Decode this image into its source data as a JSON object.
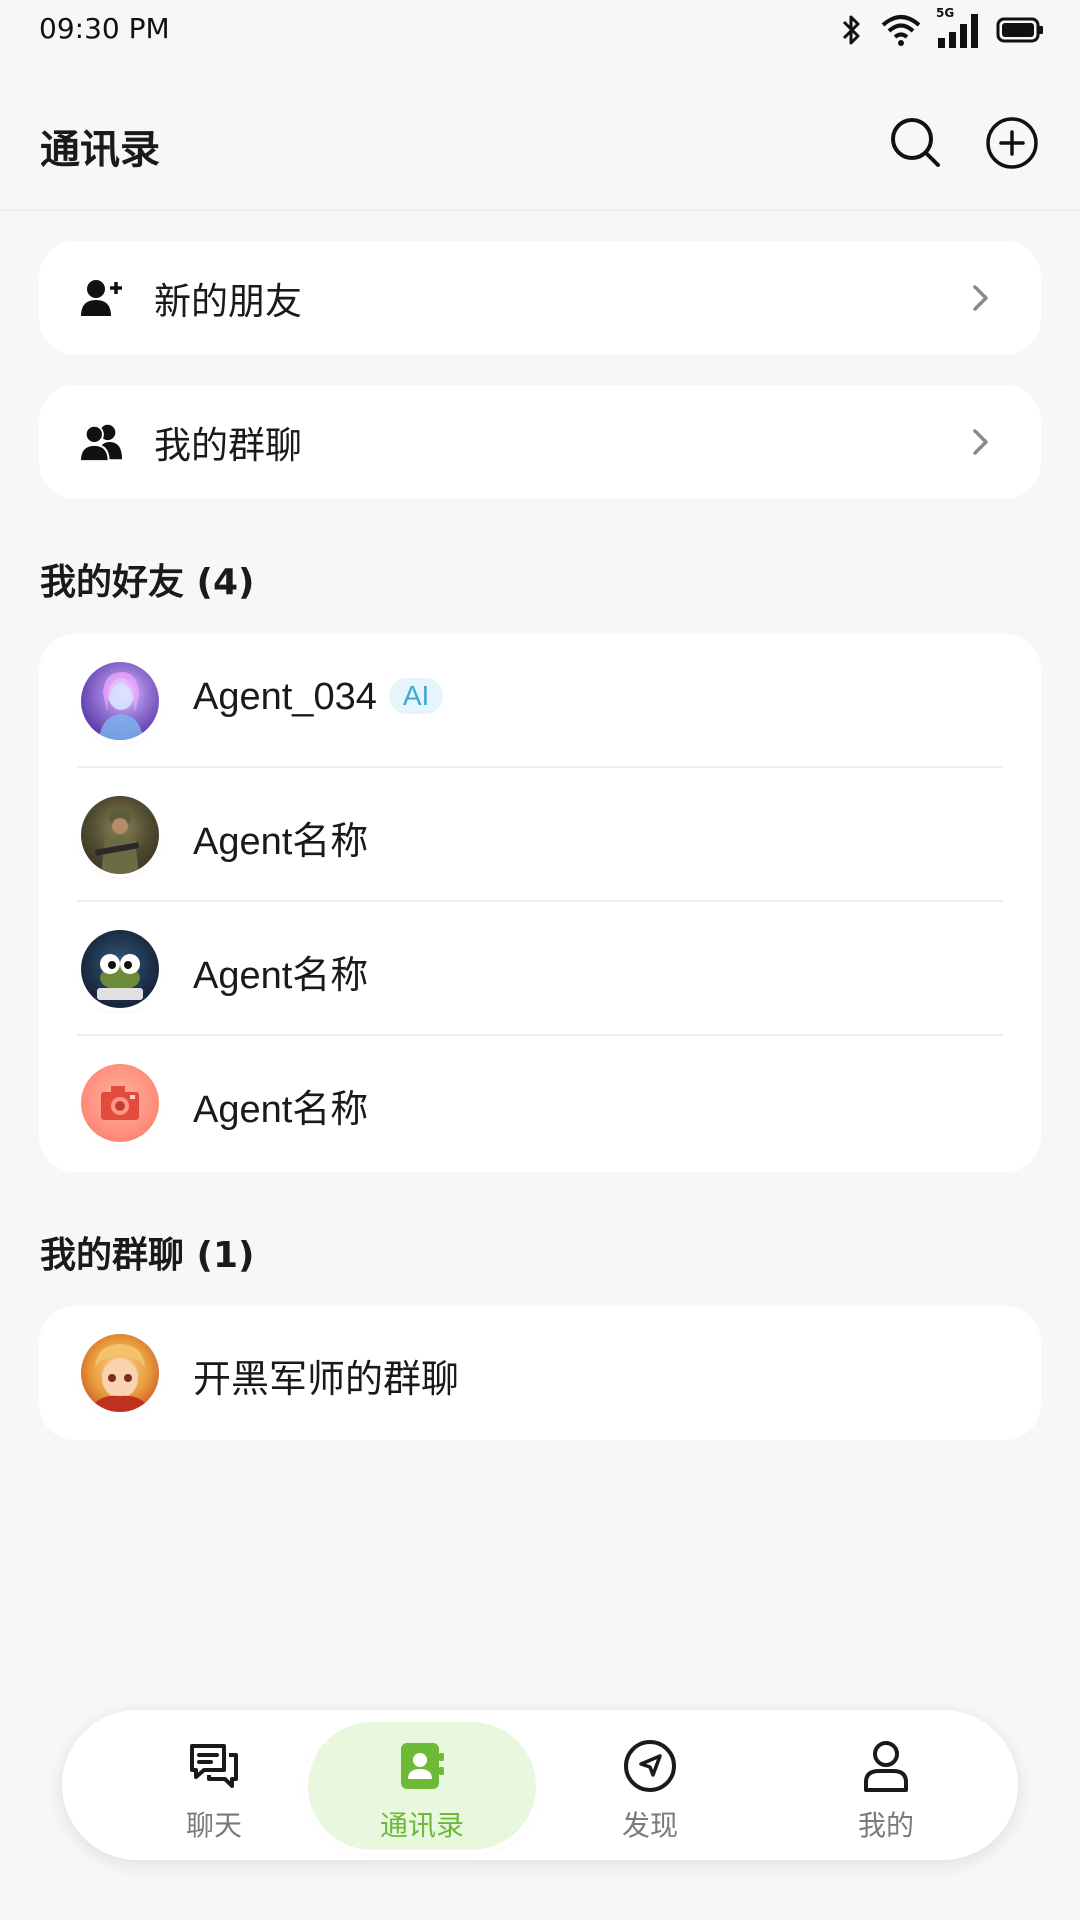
{
  "status_bar": {
    "time": "09:30 PM",
    "network": "5G"
  },
  "header": {
    "title": "通讯录",
    "icons": [
      "search-icon",
      "add-circle-icon"
    ]
  },
  "nav_items": [
    {
      "label": "新的朋友",
      "icon": "add-user-icon"
    },
    {
      "label": "我的群聊",
      "icon": "group-icon"
    }
  ],
  "friends_section": {
    "title": "我的好友 (4)",
    "items": [
      {
        "name": "Agent_034",
        "badge": "AI"
      },
      {
        "name": "Agent名称"
      },
      {
        "name": "Agent名称"
      },
      {
        "name": "Agent名称"
      }
    ]
  },
  "groups_section": {
    "title": "我的群聊 (1)",
    "items": [
      {
        "name": "开黑军师的群聊"
      }
    ]
  },
  "tabbar": {
    "tabs": [
      {
        "label": "聊天",
        "icon": "chat-icon"
      },
      {
        "label": "通讯录",
        "icon": "contacts-icon",
        "active": true
      },
      {
        "label": "发现",
        "icon": "compass-icon"
      },
      {
        "label": "我的",
        "icon": "profile-icon"
      }
    ]
  },
  "colors": {
    "accent": "#6cba37",
    "accent_bg": "#e9f7df",
    "ai_badge_text": "#3ba9d8",
    "ai_badge_bg": "#e6f4fb",
    "background": "#f7f7f7"
  }
}
